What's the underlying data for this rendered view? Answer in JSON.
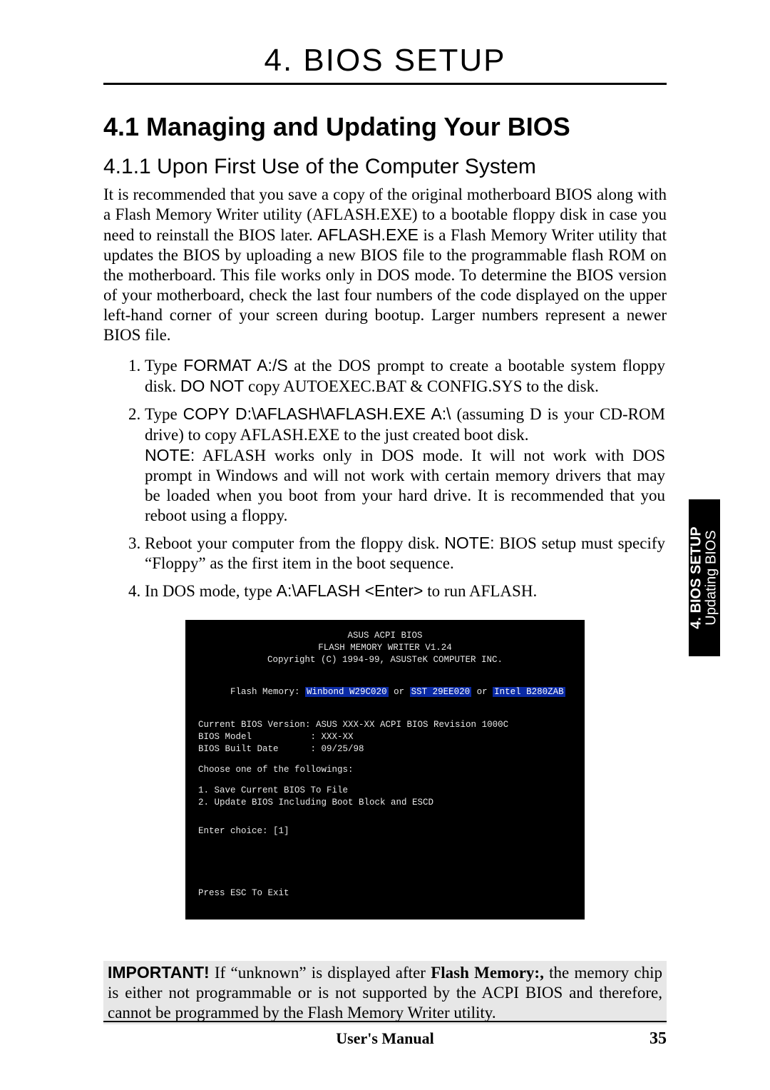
{
  "chapter_title": "4. BIOS SETUP",
  "section_title": "4.1  Managing and Updating Your BIOS",
  "subsection_title": "4.1.1 Upon First Use of the Computer System",
  "intro_parts": {
    "p1a": "It is recommended that you save a copy of the original motherboard BIOS along with a Flash Memory Writer utility (AFLASH.EXE) to a bootable floppy disk in case you need to reinstall the BIOS later. ",
    "aflash": "AFLASH.EXE",
    "p1b": " is a Flash Memory Writer utility that updates the BIOS by uploading a new BIOS file to the programmable flash ROM on the motherboard. This file works only in DOS mode. To determine the BIOS version of your motherboard, check the last four numbers of the code displayed on the upper left-hand corner of your screen during bootup. Larger numbers represent a newer BIOS file."
  },
  "steps": {
    "s1a": "Type ",
    "s1cmd": "FORMAT A:/S",
    "s1b": " at the DOS prompt to create a bootable system floppy disk. ",
    "s1donot": "DO NOT",
    "s1c": " copy AUTOEXEC.BAT & CONFIG.SYS to the disk.",
    "s2a": "Type ",
    "s2cmd": "COPY D:\\AFLASH\\AFLASH.EXE A:\\",
    "s2b": " (assuming D is your CD-ROM drive) to copy AFLASH.EXE to the just created boot disk.",
    "s2note_label": "NOTE:",
    "s2note_body": " AFLASH works only in DOS mode. It will not work with DOS prompt in Windows and will not work with certain memory drivers that may be loaded when you boot from your hard drive. It is recommended that you reboot using a floppy.",
    "s3a": "Reboot your computer from the floppy disk. ",
    "s3note_label": "NOTE:",
    "s3b": " BIOS setup must specify “Floppy” as the first item in the boot sequence.",
    "s4a": "In DOS mode, type ",
    "s4cmd": "A:\\AFLASH <Enter>",
    "s4b": " to run AFLASH."
  },
  "terminal": {
    "t1": "ASUS ACPI BIOS",
    "t2": "FLASH MEMORY WRITER V1.24",
    "t3": "Copyright (C) 1994-99, ASUSTeK COMPUTER INC.",
    "flash_label": "Flash Memory: ",
    "flash_chip1": "Winbond W29C020",
    "flash_or1": " or ",
    "flash_chip2": "SST 29EE020",
    "flash_or2": " or ",
    "flash_chip3": "Intel B280ZAB",
    "cur_ver": "Current BIOS Version: ASUS XXX-XX ACPI BIOS Revision 1000C",
    "bios_model": "BIOS Model           : XXX-XX",
    "built_date": "BIOS Built Date      : 09/25/98",
    "choose": "Choose one of the followings:",
    "opt1": "1. Save Current BIOS To File",
    "opt2": "2. Update BIOS Including Boot Block and ESCD",
    "enter_choice": "Enter choice: [1]",
    "esc": "Press ESC To Exit"
  },
  "important": {
    "label": "IMPORTANT!",
    "body_a": " If “unknown” is displayed after ",
    "bold_mid": "Flash Memory:,",
    "body_b": " the memory chip is either not programmable or is not supported by the ACPI BIOS and therefore, cannot be programmed by the Flash Memory Writer utility."
  },
  "footer": {
    "center": "User's Manual",
    "page_num": "35"
  },
  "thumb_tab": {
    "line1": "4. BIOS SETUP",
    "line2": "Updating BIOS"
  }
}
